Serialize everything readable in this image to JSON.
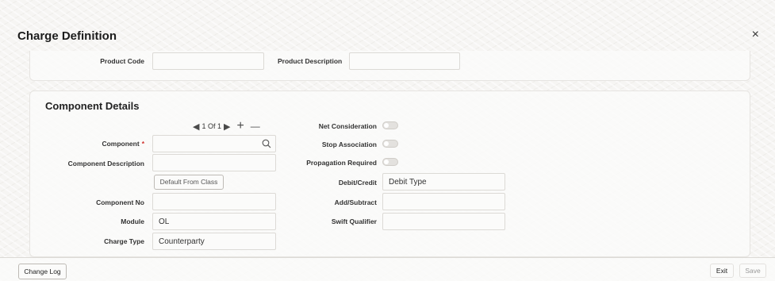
{
  "window": {
    "title": "Charge Definition",
    "close_symbol": "×"
  },
  "header_fields": {
    "product_code_label": "Product Code",
    "product_code_value": "",
    "product_description_label": "Product Description",
    "product_description_value": ""
  },
  "component_details": {
    "section_title": "Component Details",
    "pager": {
      "prev": "◀",
      "text": "1 Of 1",
      "next": "▶",
      "add": "+",
      "remove": "—"
    },
    "component_label": "Component",
    "required_mark": "*",
    "component_value": "",
    "component_description_label": "Component Description",
    "component_description_value": "",
    "default_from_class_button": "Default From Class",
    "component_no_label": "Component No",
    "component_no_value": "",
    "module_label": "Module",
    "module_value": "OL",
    "charge_type_label": "Charge Type",
    "charge_type_value": "Counterparty",
    "net_consideration_label": "Net Consideration",
    "net_consideration_on": false,
    "stop_association_label": "Stop Association",
    "stop_association_on": false,
    "propagation_required_label": "Propagation Required",
    "propagation_required_on": false,
    "debit_credit_label": "Debit/Credit",
    "debit_credit_value": "Debit Type",
    "add_subtract_label": "Add/Subtract",
    "add_subtract_value": "",
    "swift_qualifier_label": "Swift Qualifier",
    "swift_qualifier_value": ""
  },
  "footer": {
    "change_log_button": "Change Log",
    "exit_button": "Exit",
    "save_button": "Save"
  },
  "colors": {
    "required": "#d0312d",
    "text": "#1f1f1f",
    "border": "#dcdad6"
  }
}
